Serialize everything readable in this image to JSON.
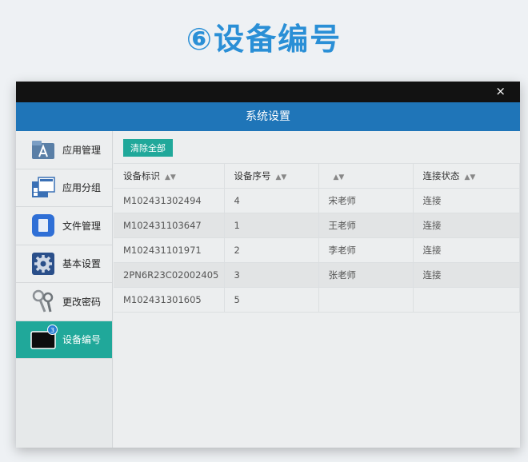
{
  "page": {
    "heading": "⑥设备编号"
  },
  "window": {
    "close_label": "×",
    "title": "系统设置"
  },
  "sidebar": {
    "items": [
      {
        "label": "应用管理",
        "icon": "app-store-icon"
      },
      {
        "label": "应用分组",
        "icon": "app-group-icon"
      },
      {
        "label": "文件管理",
        "icon": "file-icon"
      },
      {
        "label": "基本设置",
        "icon": "gear-icon"
      },
      {
        "label": "更改密码",
        "icon": "keys-icon"
      },
      {
        "label": "设备编号",
        "icon": "device-icon",
        "badge": "3",
        "active": true
      }
    ]
  },
  "toolbar": {
    "clear_label": "清除全部"
  },
  "table": {
    "headers": [
      "设备标识",
      "设备序号",
      "",
      "连接状态"
    ],
    "rows": [
      [
        "M102431302494",
        "4",
        "宋老师",
        "连接"
      ],
      [
        "M102431103647",
        "1",
        "王老师",
        "连接"
      ],
      [
        "M102431101971",
        "2",
        "李老师",
        "连接"
      ],
      [
        "2PN6R23C02002405",
        "3",
        "张老师",
        "连接"
      ],
      [
        "M102431301605",
        "5",
        "",
        ""
      ]
    ]
  },
  "colors": {
    "accent": "#20a89a",
    "header": "#1f75b8",
    "heading": "#2a8fd6"
  }
}
